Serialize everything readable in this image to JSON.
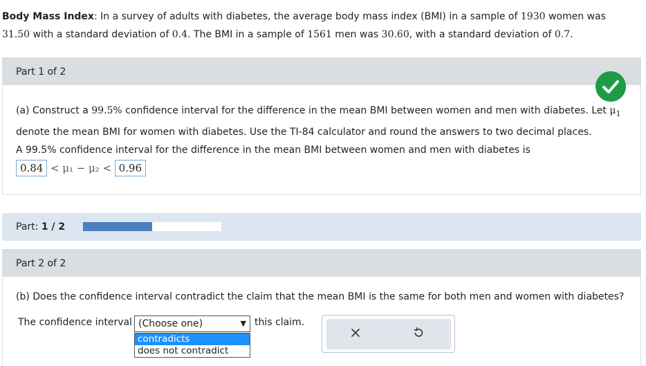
{
  "problem": {
    "title": "Body Mass Index",
    "intro": ": In a survey of adults with diabetes, the average body mass index (BMI) in a sample of ",
    "n_women": "1930",
    "mid1": " women was",
    "mean_women": "31.50",
    "mid2": " with a standard deviation of ",
    "sd_women": "0.4",
    "mid3": ". The BMI in a sample of ",
    "n_men": "1561",
    "mid4": " men was ",
    "mean_men": "30.60",
    "mid5": ", with a standard deviation of ",
    "sd_men": "0.7",
    "end": "."
  },
  "part1": {
    "header": "Part 1 of 2",
    "question_a1": "(a) Construct a ",
    "conf": "99.5%",
    "question_a2": " confidence interval for the difference in the mean BMI between women and men with diabetes. Let ",
    "mu1": "μ",
    "sub1": "1",
    "question_a3": "denote the mean BMI for women with diabetes. Use the TI-84 calculator and round the answers to two decimal places.",
    "answer_intro": "A 99.5% confidence interval for the difference in the mean BMI between women and men with diabetes is",
    "lower": "0.84",
    "expr": "< μ₁ − μ₂ <",
    "upper": "0.96",
    "status": "correct"
  },
  "progress": {
    "label_prefix": "Part: ",
    "label_value": "1 / 2",
    "fraction": 0.5
  },
  "part2": {
    "header": "Part 2 of 2",
    "question_b": "(b) Does the confidence interval contradict the claim that the mean BMI is the same for both men and women with diabetes?",
    "lead": "The confidence interval",
    "select_value": "(Choose one)",
    "options": [
      "contradicts",
      "does not contradict"
    ],
    "trail": "this claim."
  },
  "actions": {
    "clear_icon": "close-icon",
    "reset_icon": "undo-icon"
  },
  "colors": {
    "correct": "#1e9b47",
    "progress_fill": "#4a7fc0",
    "header_bg": "#d9dee3",
    "option_highlight": "#1e90ff"
  }
}
